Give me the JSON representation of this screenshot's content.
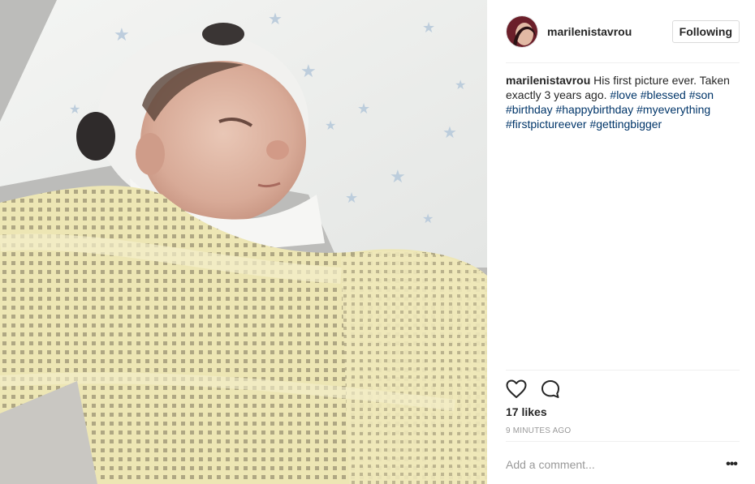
{
  "post": {
    "image_alt": "Newborn baby wrapped in a yellow cellular blanket",
    "author": {
      "username": "marilenistavrou",
      "avatar_icon": "profile-avatar"
    },
    "follow_button": {
      "label": "Following"
    },
    "caption": {
      "username": "marilenistavrou",
      "text": "His first picture ever. Taken exactly 3 years ago.",
      "hashtags": [
        "#love",
        "#blessed",
        "#son",
        "#birthday",
        "#happybirthday",
        "#myeverything",
        "#firstpictureever",
        "#gettingbigger"
      ]
    },
    "actions": {
      "like_icon": "heart-outline-icon",
      "comment_icon": "comment-bubble-icon"
    },
    "likes_text": "17 likes",
    "timestamp": "9 MINUTES AGO",
    "comment_input": {
      "placeholder": "Add a comment..."
    },
    "more_options_label": "•••"
  },
  "colors": {
    "hashtag": "#003569",
    "divider": "#efefef",
    "muted": "#999999",
    "text": "#262626"
  }
}
